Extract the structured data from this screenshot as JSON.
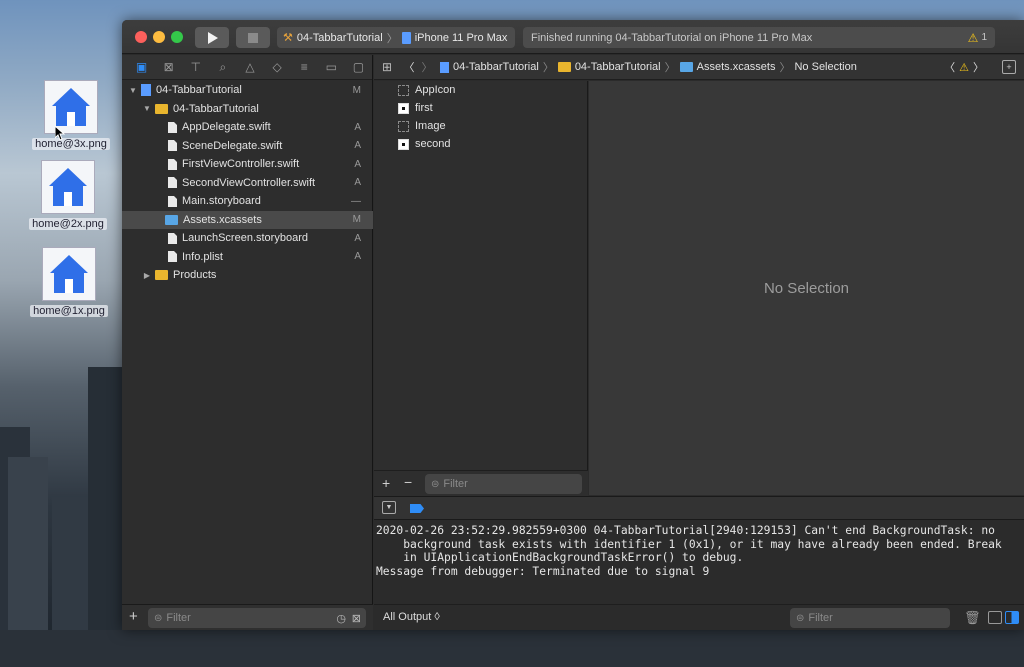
{
  "desktop": {
    "icons": [
      {
        "label": "home@3x.png"
      },
      {
        "label": "home@2x.png"
      },
      {
        "label": "home@1x.png"
      }
    ]
  },
  "toolbar": {
    "scheme_name": "04-TabbarTutorial",
    "device_name": "iPhone 11 Pro Max",
    "status_text": "Finished running 04-TabbarTutorial on iPhone 11 Pro Max",
    "warning_count": "1"
  },
  "navigator": {
    "project": {
      "name": "04-TabbarTutorial",
      "status": "M"
    },
    "group": {
      "name": "04-TabbarTutorial"
    },
    "files": [
      {
        "name": "AppDelegate.swift",
        "status": "A"
      },
      {
        "name": "SceneDelegate.swift",
        "status": "A"
      },
      {
        "name": "FirstViewController.swift",
        "status": "A"
      },
      {
        "name": "SecondViewController.swift",
        "status": "A"
      },
      {
        "name": "Main.storyboard",
        "status": "—"
      },
      {
        "name": "Assets.xcassets",
        "status": "M"
      },
      {
        "name": "LaunchScreen.storyboard",
        "status": "A"
      },
      {
        "name": "Info.plist",
        "status": "A"
      }
    ],
    "products": {
      "name": "Products"
    },
    "filter_placeholder": "Filter"
  },
  "jumpbar": {
    "crumbs": [
      "04-TabbarTutorial",
      "04-TabbarTutorial",
      "Assets.xcassets",
      "No Selection"
    ]
  },
  "assets": {
    "items": [
      {
        "name": "AppIcon"
      },
      {
        "name": "first"
      },
      {
        "name": "Image"
      },
      {
        "name": "second"
      }
    ],
    "filter_placeholder": "Filter"
  },
  "detail": {
    "empty_text": "No Selection"
  },
  "console": {
    "log": "2020-02-26 23:52:29.982559+0300 04-TabbarTutorial[2940:129153] Can't end BackgroundTask: no\n    background task exists with identifier 1 (0x1), or it may have already been ended. Break\n    in UIApplicationEndBackgroundTaskError() to debug.\nMessage from debugger: Terminated due to signal 9",
    "output_selector": "All Output ◊",
    "filter_placeholder": "Filter"
  },
  "colors": {
    "accent": "#2f8df7",
    "folder": "#e9b52e",
    "warning": "#f5c518"
  }
}
